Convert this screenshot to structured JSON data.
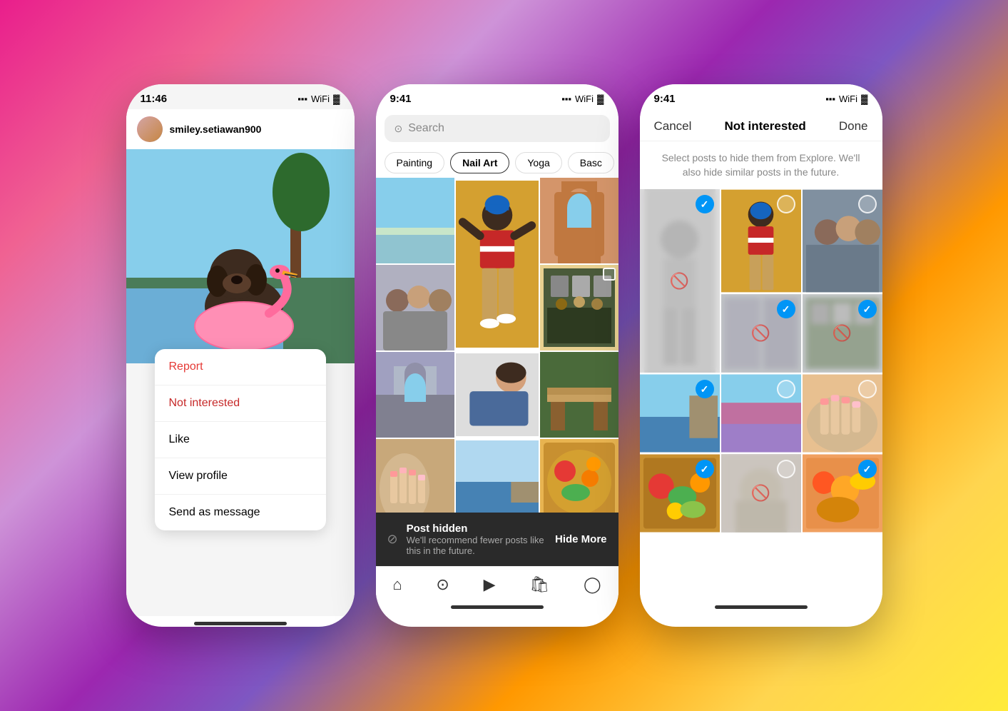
{
  "background": {
    "gradient": "linear-gradient(135deg, #e91e8c, #ce93d8, #9c27b0, #ff9800, #ffeb3b)"
  },
  "phone1": {
    "status_time": "11:46",
    "username": "smiley.setiawan900",
    "menu_items": [
      {
        "id": "report",
        "label": "Report",
        "style": "red"
      },
      {
        "id": "not_interested",
        "label": "Not interested",
        "style": "dark-red"
      },
      {
        "id": "like",
        "label": "Like",
        "style": "normal"
      },
      {
        "id": "view_profile",
        "label": "View profile",
        "style": "normal"
      },
      {
        "id": "send_message",
        "label": "Send as message",
        "style": "normal"
      }
    ]
  },
  "phone2": {
    "status_time": "9:41",
    "search_placeholder": "Search",
    "tags": [
      "Painting",
      "Nail Art",
      "Yoga",
      "Basc"
    ],
    "active_tag_index": 1,
    "toast": {
      "title": "Post hidden",
      "subtitle": "We'll recommend fewer posts like this in the future.",
      "action": "Hide More"
    },
    "nav_icons": [
      "home",
      "search",
      "reels",
      "shop",
      "profile"
    ]
  },
  "phone3": {
    "status_time": "9:41",
    "header": {
      "cancel": "Cancel",
      "title": "Not interested",
      "done": "Done"
    },
    "subtitle": "Select posts to hide them from Explore. We'll also hide similar posts in the future.",
    "grid_cells": [
      {
        "selected": true,
        "blurred": true
      },
      {
        "selected": false,
        "blurred": false
      },
      {
        "selected": false,
        "blurred": false
      },
      {
        "selected": false,
        "blurred": false
      },
      {
        "selected": true,
        "blurred": true
      },
      {
        "selected": true,
        "blurred": true
      },
      {
        "selected": false,
        "blurred": false
      },
      {
        "selected": true,
        "blurred": false
      },
      {
        "selected": false,
        "blurred": true
      },
      {
        "selected": false,
        "blurred": false
      },
      {
        "selected": true,
        "blurred": false
      }
    ]
  }
}
